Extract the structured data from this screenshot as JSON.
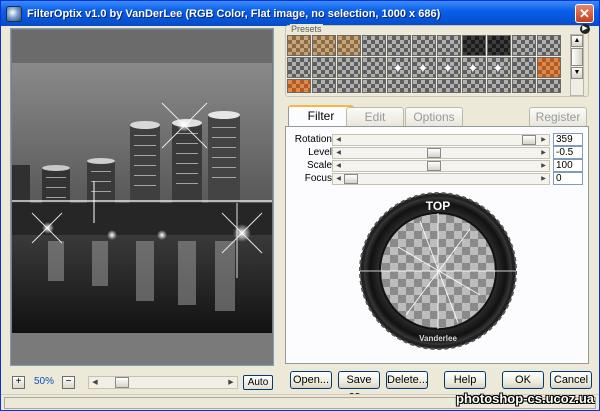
{
  "window": {
    "title": "FilterOptix v1.0 by VanDerLee (RGB Color, Flat image, no selection, 1000 x 686)",
    "close_glyph": "✕",
    "app_icon": "filteroptix-lens-icon"
  },
  "preview": {
    "zoom_label": "50%",
    "zoom_in_glyph": "+",
    "zoom_out_glyph": "−",
    "auto_label": "Auto"
  },
  "presets": {
    "label": "Presets",
    "menu_icon": "circle-arrow-icon"
  },
  "tabs": [
    {
      "label": "Filter",
      "active": true
    },
    {
      "label": "Edit",
      "active": false
    },
    {
      "label": "Options",
      "active": false
    },
    {
      "label": "Register",
      "active": false
    }
  ],
  "params": [
    {
      "label": "Rotation",
      "value": "359",
      "level": 0.99
    },
    {
      "label": "Level",
      "value": "-0.5",
      "level": 0.46
    },
    {
      "label": "Scale",
      "value": "100",
      "level": 0.46
    },
    {
      "label": "Focus",
      "value": "0",
      "level": 0.0
    }
  ],
  "dial": {
    "top_label": "TOP",
    "brand_label": "Vanderlee"
  },
  "buttons": {
    "open": "Open...",
    "save_as": "Save as...",
    "delete": "Delete...",
    "help": "Help",
    "ok": "OK",
    "cancel": "Cancel"
  },
  "watermark": "photoshop-cs.ucoz.ua",
  "colors": {
    "titlebar": "#0553d6",
    "tab_highlight": "#f7b64a",
    "window_bg": "#ece9d8"
  }
}
